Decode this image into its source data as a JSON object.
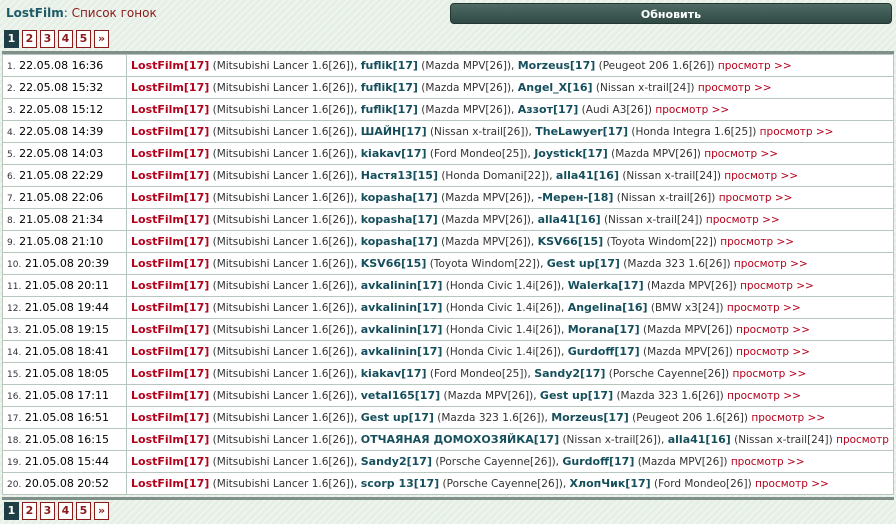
{
  "header": {
    "brand": "LostFilm",
    "separator": ":",
    "subtitle": "Список гонок"
  },
  "refresh_label": "Обновить",
  "pager": {
    "pages": [
      "1",
      "2",
      "3",
      "4",
      "5"
    ],
    "active": "1",
    "next": "»"
  },
  "more_label": "просмотр >>",
  "rows": [
    {
      "n": "1.",
      "dt": "22.05.08 16:36",
      "p": [
        [
          "LostFilm",
          "[17]",
          "Mitsubishi Lancer 1.6[26]"
        ],
        [
          "fuflik",
          "[17]",
          "Mazda MPV[26]"
        ],
        [
          "Morzeus",
          "[17]",
          "Peugeot 206 1.6[26]"
        ]
      ]
    },
    {
      "n": "2.",
      "dt": "22.05.08 15:32",
      "p": [
        [
          "LostFilm",
          "[17]",
          "Mitsubishi Lancer 1.6[26]"
        ],
        [
          "fuflik",
          "[17]",
          "Mazda MPV[26]"
        ],
        [
          "Angel_X",
          "[16]",
          "Nissan x-trail[24]"
        ]
      ]
    },
    {
      "n": "3.",
      "dt": "22.05.08 15:12",
      "p": [
        [
          "LostFilm",
          "[17]",
          "Mitsubishi Lancer 1.6[26]"
        ],
        [
          "fuflik",
          "[17]",
          "Mazda MPV[26]"
        ],
        [
          "Аззот",
          "[17]",
          "Audi A3[26]"
        ]
      ]
    },
    {
      "n": "4.",
      "dt": "22.05.08 14:39",
      "p": [
        [
          "LostFilm",
          "[17]",
          "Mitsubishi Lancer 1.6[26]"
        ],
        [
          "ШАЙН",
          "[17]",
          "Nissan x-trail[26]"
        ],
        [
          "TheLawyer",
          "[17]",
          "Honda Integra 1.6[25]"
        ]
      ]
    },
    {
      "n": "5.",
      "dt": "22.05.08 14:03",
      "p": [
        [
          "LostFilm",
          "[17]",
          "Mitsubishi Lancer 1.6[26]"
        ],
        [
          "kiakav",
          "[17]",
          "Ford Mondeo[25]"
        ],
        [
          "Joystick",
          "[17]",
          "Mazda MPV[26]"
        ]
      ]
    },
    {
      "n": "6.",
      "dt": "21.05.08 22:29",
      "p": [
        [
          "LostFilm",
          "[17]",
          "Mitsubishi Lancer 1.6[26]"
        ],
        [
          "Настя13",
          "[15]",
          "Honda Domani[22]"
        ],
        [
          "alla41",
          "[16]",
          "Nissan x-trail[24]"
        ]
      ]
    },
    {
      "n": "7.",
      "dt": "21.05.08 22:06",
      "p": [
        [
          "LostFilm",
          "[17]",
          "Mitsubishi Lancer 1.6[26]"
        ],
        [
          "kopasha",
          "[17]",
          "Mazda MPV[26]"
        ],
        [
          "-Мерен-",
          "[18]",
          "Nissan x-trail[26]"
        ]
      ]
    },
    {
      "n": "8.",
      "dt": "21.05.08 21:34",
      "p": [
        [
          "LostFilm",
          "[17]",
          "Mitsubishi Lancer 1.6[26]"
        ],
        [
          "kopasha",
          "[17]",
          "Mazda MPV[26]"
        ],
        [
          "alla41",
          "[16]",
          "Nissan x-trail[24]"
        ]
      ]
    },
    {
      "n": "9.",
      "dt": "21.05.08 21:10",
      "p": [
        [
          "LostFilm",
          "[17]",
          "Mitsubishi Lancer 1.6[26]"
        ],
        [
          "kopasha",
          "[17]",
          "Mazda MPV[26]"
        ],
        [
          "KSV66",
          "[15]",
          "Toyota Windom[22]"
        ]
      ]
    },
    {
      "n": "10.",
      "dt": "21.05.08 20:39",
      "p": [
        [
          "LostFilm",
          "[17]",
          "Mitsubishi Lancer 1.6[26]"
        ],
        [
          "KSV66",
          "[15]",
          "Toyota Windom[22]"
        ],
        [
          "Gest up",
          "[17]",
          "Mazda 323 1.6[26]"
        ]
      ]
    },
    {
      "n": "11.",
      "dt": "21.05.08 20:11",
      "p": [
        [
          "LostFilm",
          "[17]",
          "Mitsubishi Lancer 1.6[26]"
        ],
        [
          "avkalinin",
          "[17]",
          "Honda Civic 1.4i[26]"
        ],
        [
          "Walerka",
          "[17]",
          "Mazda MPV[26]"
        ]
      ]
    },
    {
      "n": "12.",
      "dt": "21.05.08 19:44",
      "p": [
        [
          "LostFilm",
          "[17]",
          "Mitsubishi Lancer 1.6[26]"
        ],
        [
          "avkalinin",
          "[17]",
          "Honda Civic 1.4i[26]"
        ],
        [
          "Angelina",
          "[16]",
          "BMW x3[24]"
        ]
      ]
    },
    {
      "n": "13.",
      "dt": "21.05.08 19:15",
      "p": [
        [
          "LostFilm",
          "[17]",
          "Mitsubishi Lancer 1.6[26]"
        ],
        [
          "avkalinin",
          "[17]",
          "Honda Civic 1.4i[26]"
        ],
        [
          "Morana",
          "[17]",
          "Mazda MPV[26]"
        ]
      ]
    },
    {
      "n": "14.",
      "dt": "21.05.08 18:41",
      "p": [
        [
          "LostFilm",
          "[17]",
          "Mitsubishi Lancer 1.6[26]"
        ],
        [
          "avkalinin",
          "[17]",
          "Honda Civic 1.4i[26]"
        ],
        [
          "Gurdoff",
          "[17]",
          "Mazda MPV[26]"
        ]
      ]
    },
    {
      "n": "15.",
      "dt": "21.05.08 18:05",
      "p": [
        [
          "LostFilm",
          "[17]",
          "Mitsubishi Lancer 1.6[26]"
        ],
        [
          "kiakav",
          "[17]",
          "Ford Mondeo[25]"
        ],
        [
          "Sandy2",
          "[17]",
          "Porsche Cayenne[26]"
        ]
      ]
    },
    {
      "n": "16.",
      "dt": "21.05.08 17:11",
      "p": [
        [
          "LostFilm",
          "[17]",
          "Mitsubishi Lancer 1.6[26]"
        ],
        [
          "vetal165",
          "[17]",
          "Mazda MPV[26]"
        ],
        [
          "Gest up",
          "[17]",
          "Mazda 323 1.6[26]"
        ]
      ]
    },
    {
      "n": "17.",
      "dt": "21.05.08 16:51",
      "p": [
        [
          "LostFilm",
          "[17]",
          "Mitsubishi Lancer 1.6[26]"
        ],
        [
          "Gest up",
          "[17]",
          "Mazda 323 1.6[26]"
        ],
        [
          "Morzeus",
          "[17]",
          "Peugeot 206 1.6[26]"
        ]
      ]
    },
    {
      "n": "18.",
      "dt": "21.05.08 16:15",
      "p": [
        [
          "LostFilm",
          "[17]",
          "Mitsubishi Lancer 1.6[26]"
        ],
        [
          "ОТЧАЯНАЯ ДОМОХОЗЯЙКА",
          "[17]",
          "Nissan x-trail[26]"
        ],
        [
          "alla41",
          "[16]",
          "Nissan x-trail[24]"
        ]
      ]
    },
    {
      "n": "19.",
      "dt": "21.05.08 15:44",
      "p": [
        [
          "LostFilm",
          "[17]",
          "Mitsubishi Lancer 1.6[26]"
        ],
        [
          "Sandy2",
          "[17]",
          "Porsche Cayenne[26]"
        ],
        [
          "Gurdoff",
          "[17]",
          "Mazda MPV[26]"
        ]
      ]
    },
    {
      "n": "20.",
      "dt": "20.05.08 20:52",
      "p": [
        [
          "LostFilm",
          "[17]",
          "Mitsubishi Lancer 1.6[26]"
        ],
        [
          "scorp 13",
          "[17]",
          "Porsche Cayenne[26]"
        ],
        [
          "ХлопЧик",
          "[17]",
          "Ford Mondeo[26]"
        ]
      ]
    }
  ]
}
